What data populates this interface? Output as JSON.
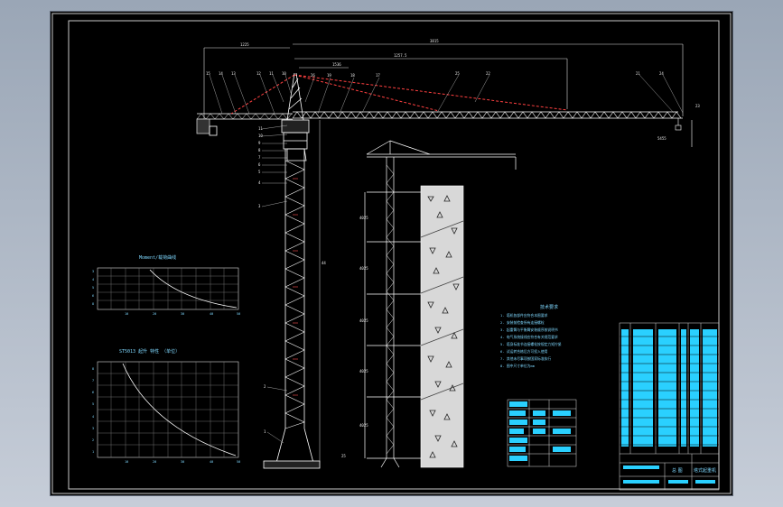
{
  "drawing": {
    "dimensions": {
      "left_span": "1225",
      "total_span": "3815",
      "mid_span": "1257.5",
      "jib_top": "1536",
      "tip": "5455",
      "tower_height": "44",
      "ground": "25"
    },
    "balloons_top": [
      "15",
      "14",
      "13",
      "12",
      "11",
      "10",
      "26",
      "19",
      "18",
      "17",
      "25",
      "22",
      "21",
      "24",
      "23"
    ],
    "balloons_left": [
      "11",
      "10",
      "9",
      "8",
      "7",
      "6",
      "5",
      "4",
      "3",
      "2",
      "1"
    ],
    "side_view_dims": [
      "4025",
      "4025",
      "4025",
      "4025",
      "4025"
    ],
    "chart1": {
      "title": "Moment/载荷曲线",
      "xlabels": [
        "10",
        "20",
        "30",
        "40",
        "50"
      ],
      "ylabels": [
        "3",
        "4",
        "5",
        "6",
        "8"
      ]
    },
    "chart2": {
      "title": "ST5013 起升 特性 （单位）",
      "xlabels": [
        "10",
        "20",
        "30",
        "40",
        "50"
      ],
      "ylabels": [
        "8",
        "7",
        "6",
        "5",
        "4",
        "3",
        "2",
        "1"
      ]
    },
    "notes": {
      "title": "技术要求",
      "lines": [
        "1. 塔机各部件应符合本图要求",
        "2. 安装前检查所有连接螺栓",
        "3. 起重臂与平衡臂安装顺序按说明书",
        "4. 电气系统接线应符合有关规范要求",
        "5. 塔身标准节连接螺栓按规定力矩拧紧",
        "6. 试运转合格后方可投入使用",
        "7. 其他未尽事项按国家标准执行",
        "8. 图中尺寸单位为mm"
      ]
    },
    "title_block": {
      "label1": "总 图",
      "label2": "塔式起重机"
    }
  }
}
